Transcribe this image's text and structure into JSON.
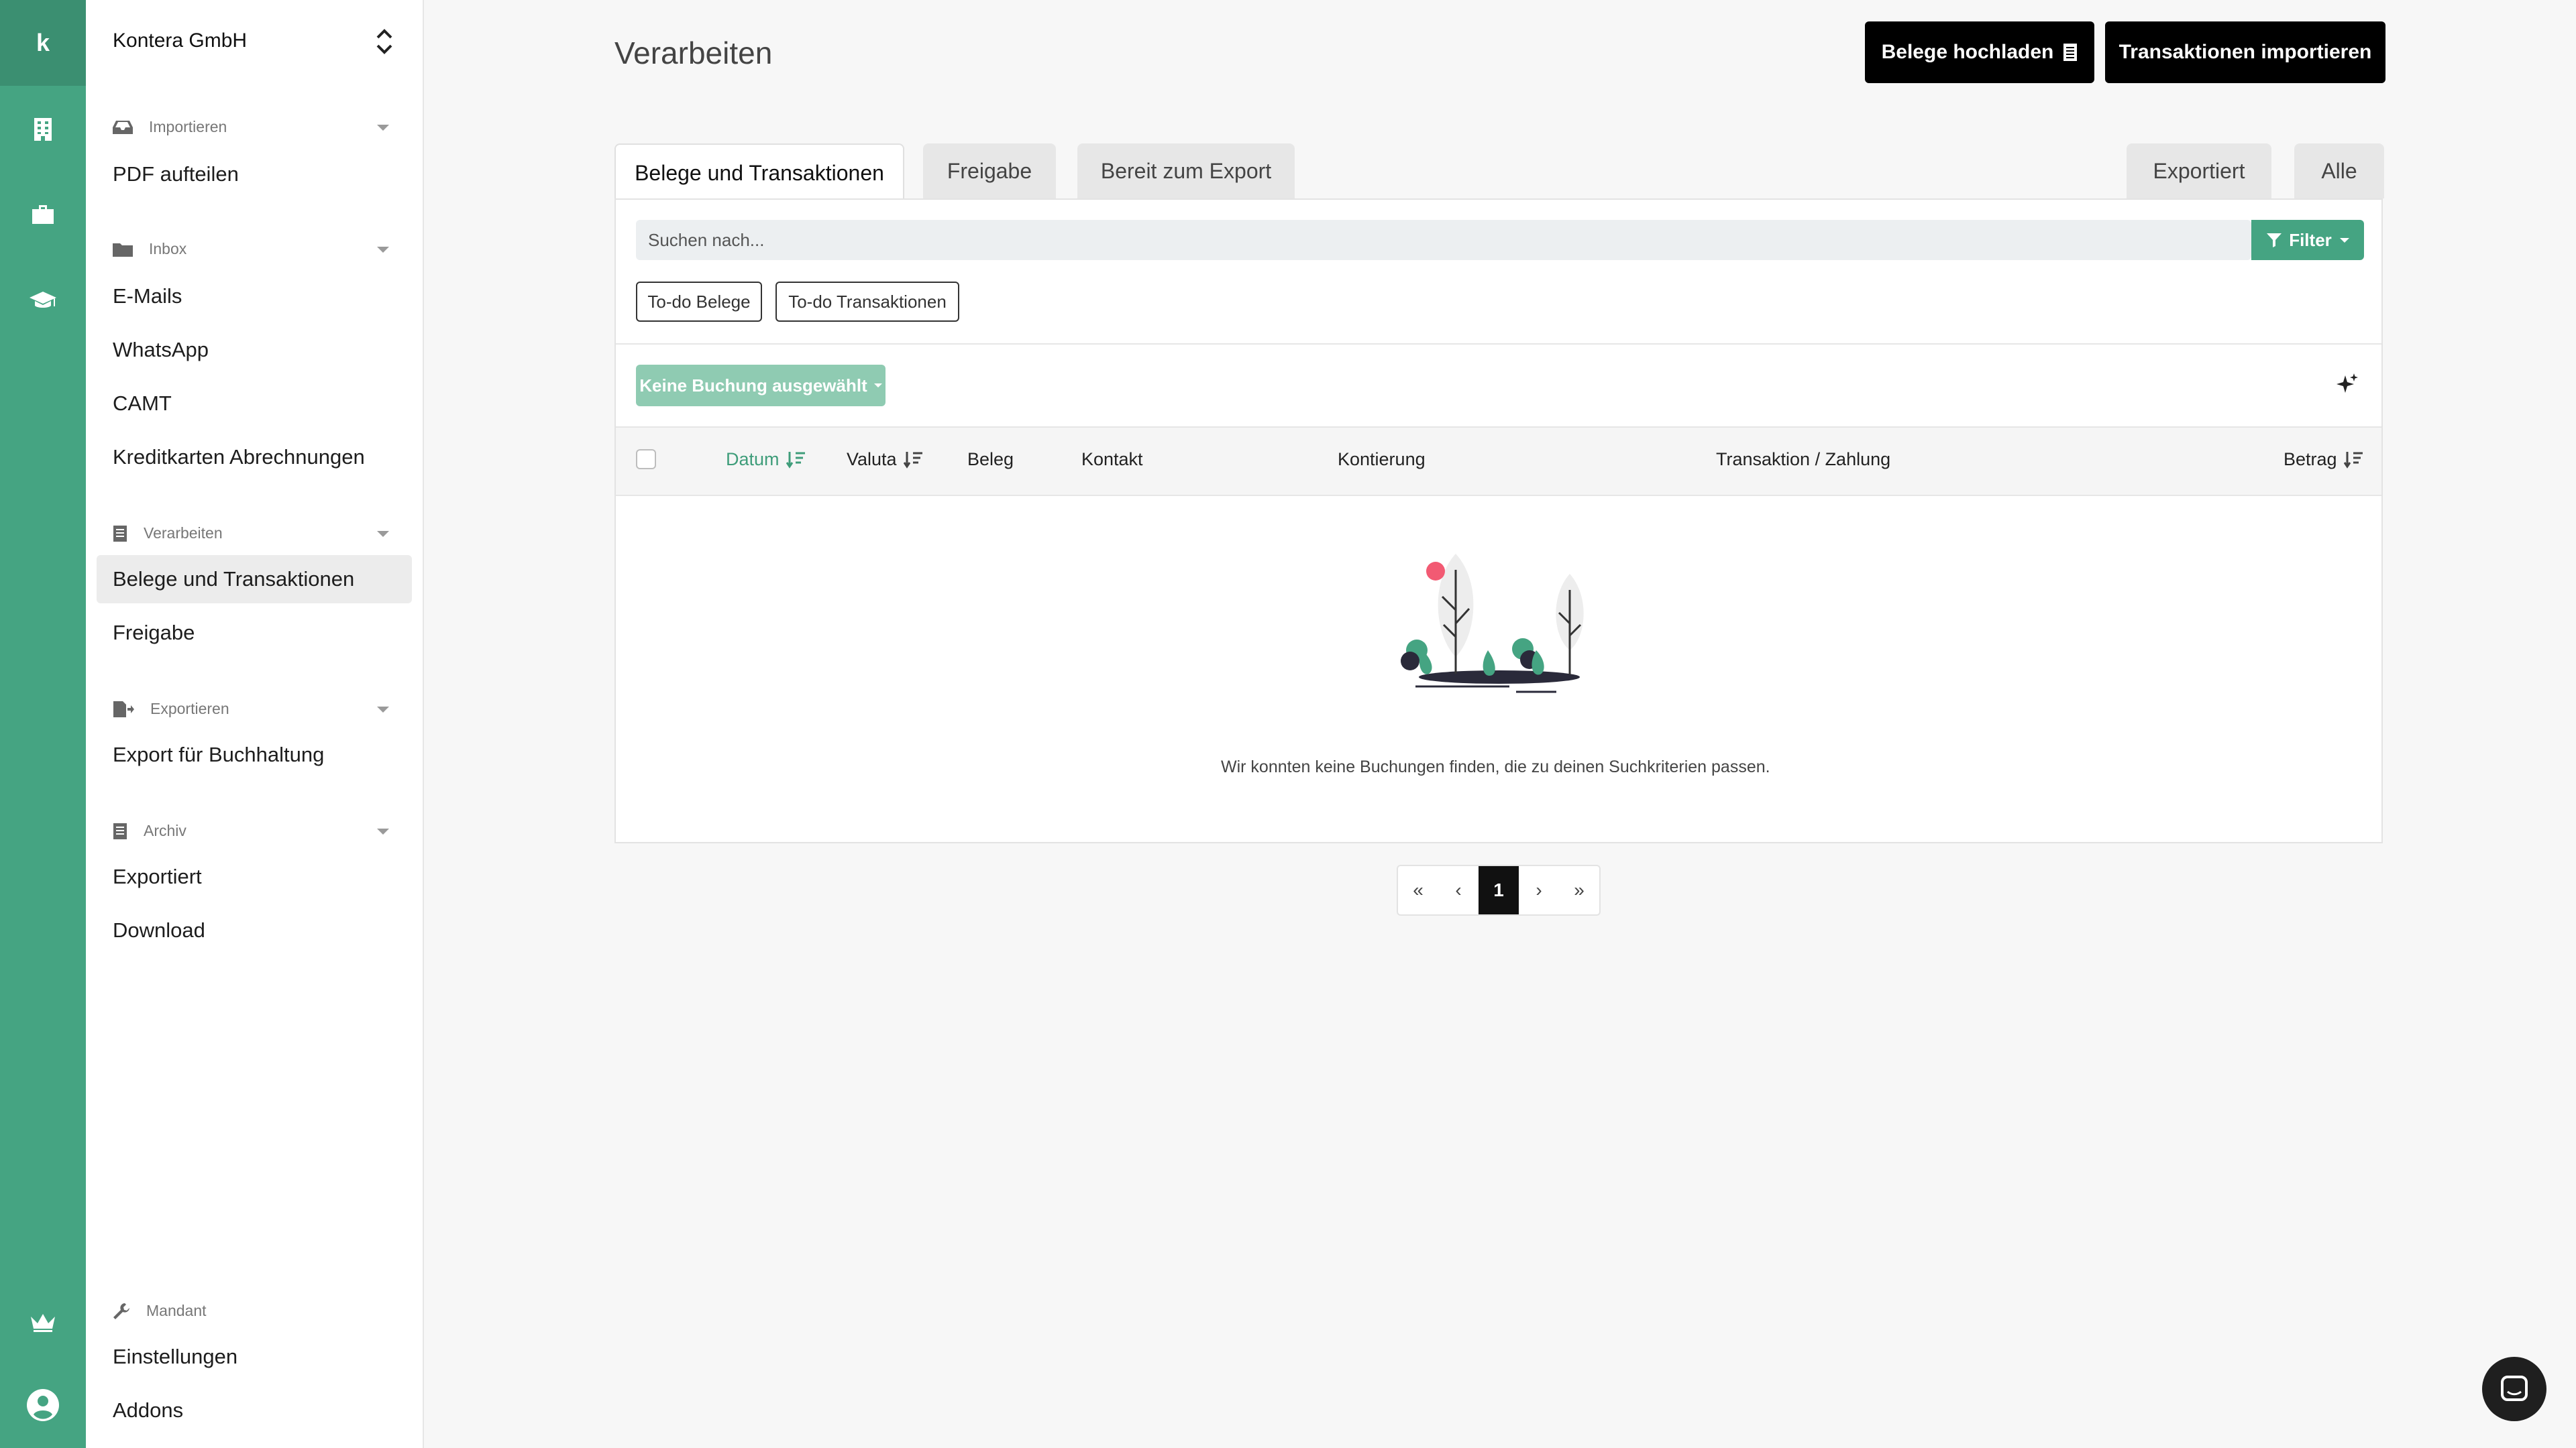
{
  "rail": {
    "brand": "k",
    "icons": [
      "building-icon",
      "briefcase-icon",
      "graduation-cap-icon",
      "crown-icon",
      "user-circle-icon"
    ]
  },
  "sidebar": {
    "company": "Kontera GmbH",
    "sections": [
      {
        "title": "Importieren",
        "icon": "inbox-tray-icon",
        "items": [
          "PDF aufteilen"
        ]
      },
      {
        "title": "Inbox",
        "icon": "folder-icon",
        "items": [
          "E-Mails",
          "WhatsApp",
          "CAMT",
          "Kreditkarten Abrechnungen"
        ]
      },
      {
        "title": "Verarbeiten",
        "icon": "receipt-icon",
        "items": [
          "Belege und Transaktionen",
          "Freigabe"
        ]
      },
      {
        "title": "Exportieren",
        "icon": "export-file-icon",
        "items": [
          "Export für Buchhaltung"
        ]
      },
      {
        "title": "Archiv",
        "icon": "archive-icon",
        "items": [
          "Exportiert",
          "Download"
        ]
      },
      {
        "title": "Mandant",
        "icon": "wrench-icon",
        "items": [
          "Einstellungen",
          "Addons"
        ]
      }
    ],
    "active_item": "Belege und Transaktionen"
  },
  "header": {
    "title": "Verarbeiten",
    "upload_button": "Belege hochladen",
    "import_button": "Transaktionen importieren"
  },
  "tabs": {
    "left": [
      "Belege und Transaktionen",
      "Freigabe",
      "Bereit zum Export"
    ],
    "right": [
      "Exportiert",
      "Alle"
    ],
    "active": "Belege und Transaktionen"
  },
  "search": {
    "placeholder": "Suchen nach...",
    "filter_label": "Filter"
  },
  "chips": [
    "To-do Belege",
    "To-do Transaktionen"
  ],
  "bulk_action": "Keine Buchung ausgewählt",
  "table": {
    "columns": [
      "Datum",
      "Valuta",
      "Beleg",
      "Kontakt",
      "Kontierung",
      "Transaktion / Zahlung",
      "Betrag"
    ],
    "sorted_column": "Datum",
    "empty_message": "Wir konnten keine Buchungen finden, die zu deinen Suchkriterien passen."
  },
  "pagination": {
    "first": "«",
    "prev": "‹",
    "current": "1",
    "next": "›",
    "last": "»"
  },
  "colors": {
    "accent": "#45a482",
    "rail": "#45a482",
    "dark_button": "#000000"
  }
}
